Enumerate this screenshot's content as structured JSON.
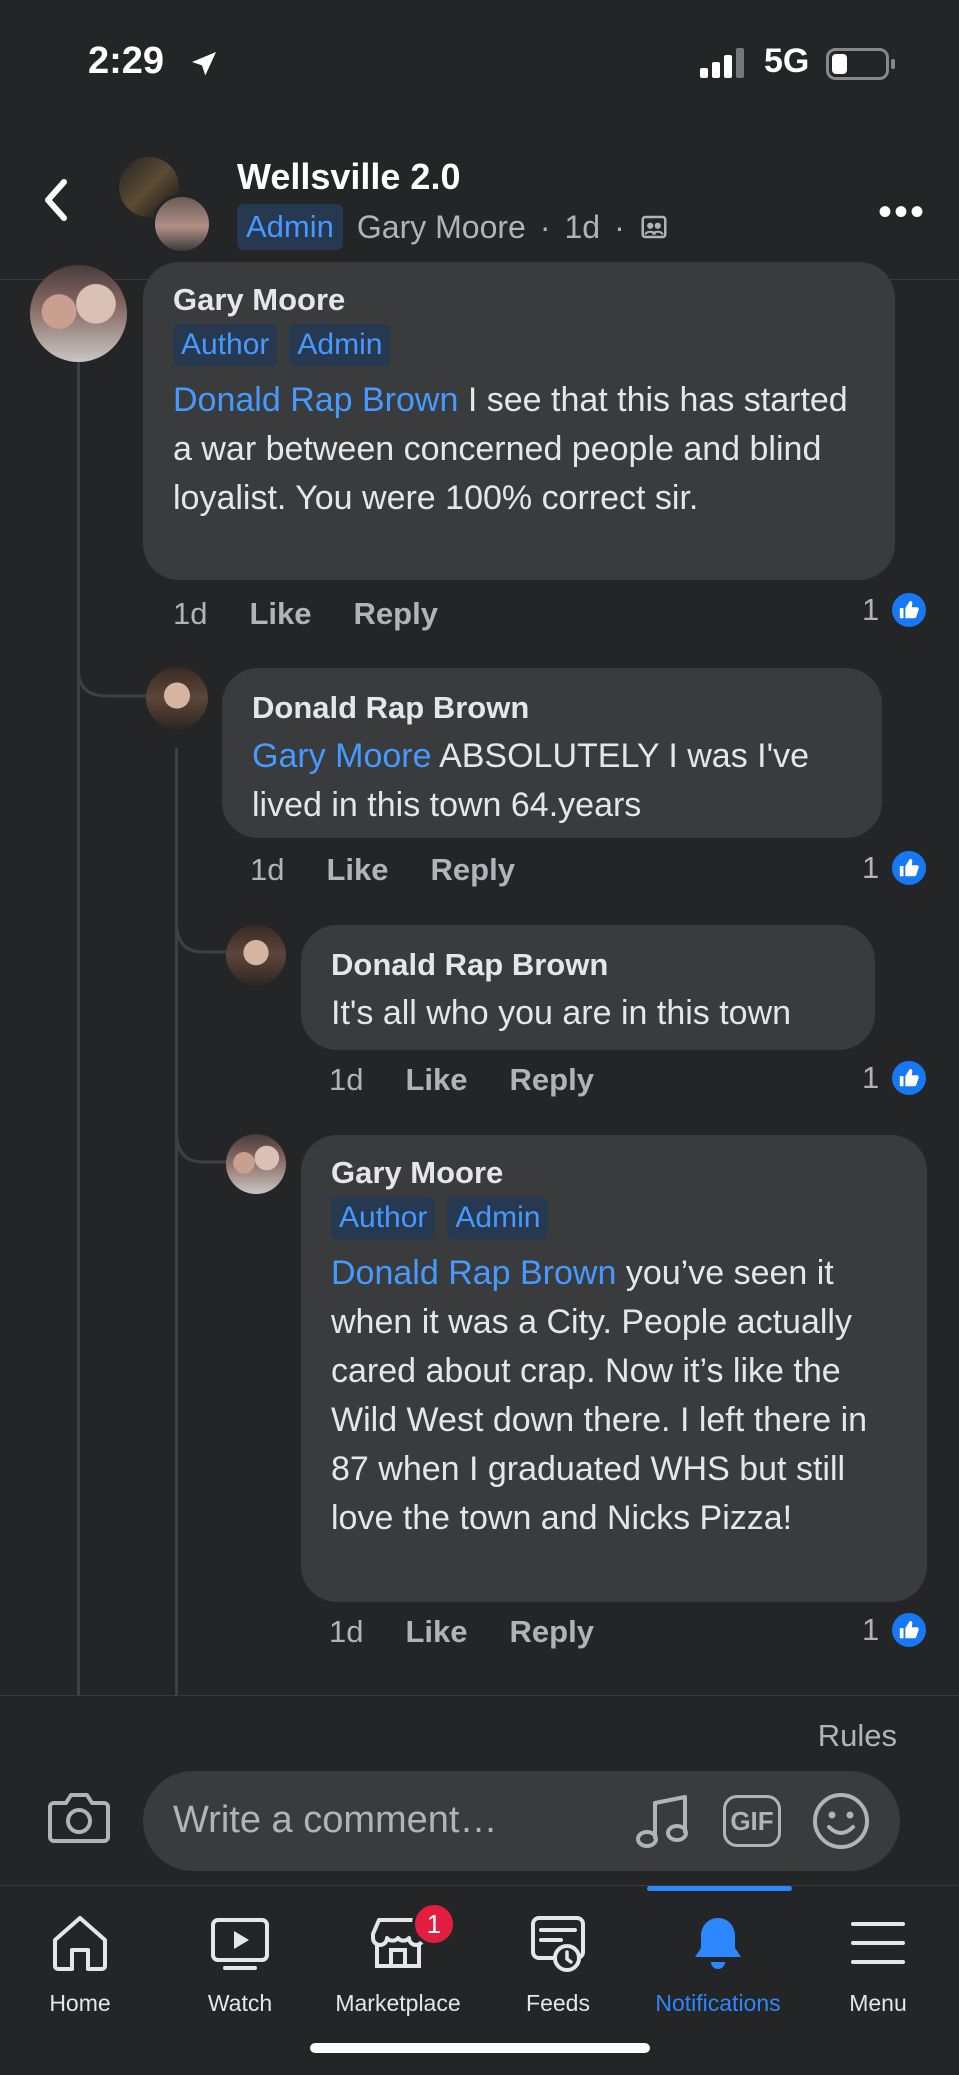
{
  "status_bar": {
    "time": "2:29",
    "network": "5G"
  },
  "header": {
    "group_name": "Wellsville 2.0",
    "badge": "Admin",
    "author": "Gary Moore",
    "separator1": "·",
    "age": "1d",
    "separator2": "·"
  },
  "comments": [
    {
      "author": "Gary Moore",
      "badges": [
        "Author",
        "Admin"
      ],
      "mention": "Donald Rap Brown",
      "text": " I see that this has started a war between concerned people and blind loyalist. You were 100% correct sir.",
      "time": "1d",
      "like": "Like",
      "reply": "Reply",
      "reactions": "1"
    },
    {
      "author": "Donald Rap Brown",
      "mention": "Gary Moore",
      "text": " ABSOLUTELY I was I've lived in this town 64.years",
      "time": "1d",
      "like": "Like",
      "reply": "Reply",
      "reactions": "1"
    },
    {
      "author": "Donald Rap Brown",
      "text": "It's all who you are in this town",
      "time": "1d",
      "like": "Like",
      "reply": "Reply",
      "reactions": "1"
    },
    {
      "author": "Gary Moore",
      "badges": [
        "Author",
        "Admin"
      ],
      "mention": "Donald Rap Brown",
      "text": " you’ve seen it when it was a City. People actually cared about crap. Now it’s like the Wild West down there. I left there in 87 when I graduated WHS but still love the town and Nicks Pizza!",
      "time": "1d",
      "like": "Like",
      "reply": "Reply",
      "reactions": "1"
    }
  ],
  "composer": {
    "rules": "Rules",
    "placeholder": "Write a comment…",
    "gif": "GIF"
  },
  "tabs": [
    {
      "label": "Home",
      "icon": "home-icon"
    },
    {
      "label": "Watch",
      "icon": "watch-icon"
    },
    {
      "label": "Marketplace",
      "icon": "marketplace-icon",
      "badge": "1"
    },
    {
      "label": "Feeds",
      "icon": "feeds-icon"
    },
    {
      "label": "Notifications",
      "icon": "bell-icon",
      "active": true
    },
    {
      "label": "Menu",
      "icon": "menu-icon"
    }
  ],
  "colors": {
    "background": "#242526",
    "bubble": "#3a3b3c",
    "accent": "#4599ff",
    "active_tab": "#2d88ff",
    "badge_red": "#e41e3f"
  }
}
